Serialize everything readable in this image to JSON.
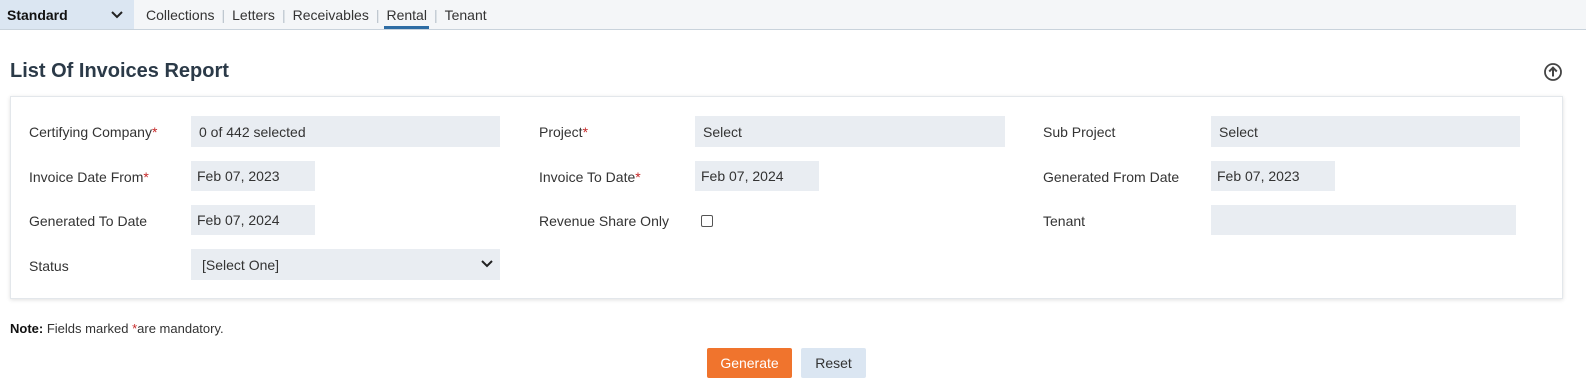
{
  "nav": {
    "module": "Standard",
    "tabs": [
      "Collections",
      "Letters",
      "Receivables",
      "Rental",
      "Tenant"
    ],
    "active_tab": "Rental"
  },
  "page": {
    "title": "List Of Invoices Report"
  },
  "form": {
    "certifying_company": {
      "label": "Certifying Company",
      "required": "*",
      "value": "0 of 442 selected"
    },
    "project": {
      "label": "Project",
      "required": "*",
      "value": "Select"
    },
    "sub_project": {
      "label": "Sub Project",
      "value": "Select"
    },
    "invoice_date_from": {
      "label": "Invoice Date From",
      "required": "*",
      "value": "Feb 07, 2023"
    },
    "invoice_to_date": {
      "label": "Invoice To Date",
      "required": "*",
      "value": "Feb 07, 2024"
    },
    "generated_from_date": {
      "label": "Generated From Date",
      "value": "Feb 07, 2023"
    },
    "generated_to_date": {
      "label": "Generated To Date",
      "value": "Feb 07, 2024"
    },
    "revenue_share_only": {
      "label": "Revenue Share Only",
      "checked": false
    },
    "tenant": {
      "label": "Tenant",
      "value": ""
    },
    "status": {
      "label": "Status",
      "value": "[Select One]"
    }
  },
  "note": {
    "prefix": "Note:",
    "text_before": "Fields marked ",
    "asterisk": "*",
    "text_after": "are mandatory."
  },
  "buttons": {
    "generate": "Generate",
    "reset": "Reset"
  },
  "colors": {
    "accent": "#f0742d",
    "required": "#c62828",
    "active_tab_underline": "#2e6da4",
    "field_bg": "#e9edf2"
  },
  "icons": {
    "module_dropdown": "chevron-down-icon",
    "collapse": "arrow-up-circle-icon",
    "status_dropdown": "chevron-down-icon"
  }
}
